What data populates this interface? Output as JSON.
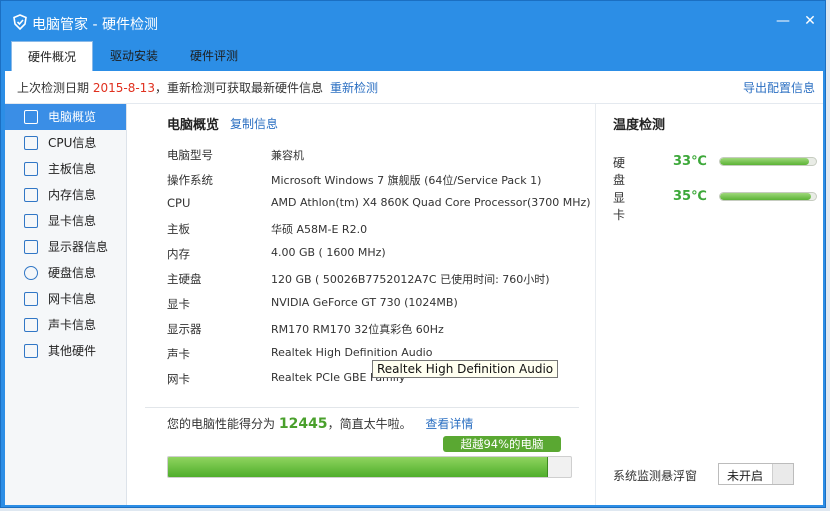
{
  "window": {
    "title": "电脑管家 - 硬件检测",
    "minimize": "—",
    "close": "✕"
  },
  "tabs": [
    {
      "label": "硬件概况",
      "active": true
    },
    {
      "label": "驱动安装",
      "active": false
    },
    {
      "label": "硬件评测",
      "active": false
    }
  ],
  "infobar": {
    "prefix": "上次检测日期",
    "date": "2015-8-13",
    "suffix": "，重新检测可获取最新硬件信息",
    "recheck": "重新检测",
    "export": "导出配置信息"
  },
  "sidebar": [
    {
      "label": "电脑概览",
      "icon": "overview-icon",
      "active": true
    },
    {
      "label": "CPU信息",
      "icon": "cpu-icon"
    },
    {
      "label": "主板信息",
      "icon": "motherboard-icon"
    },
    {
      "label": "内存信息",
      "icon": "memory-icon"
    },
    {
      "label": "显卡信息",
      "icon": "gpu-icon"
    },
    {
      "label": "显示器信息",
      "icon": "monitor-icon"
    },
    {
      "label": "硬盘信息",
      "icon": "disk-icon"
    },
    {
      "label": "网卡信息",
      "icon": "network-icon"
    },
    {
      "label": "声卡信息",
      "icon": "sound-icon"
    },
    {
      "label": "其他硬件",
      "icon": "other-hardware-icon"
    }
  ],
  "overview": {
    "title": "电脑概览",
    "copy": "复制信息",
    "rows": [
      {
        "key": "电脑型号",
        "value": "兼容机"
      },
      {
        "key": "操作系统",
        "value": "Microsoft Windows 7 旗舰版 (64位/Service Pack 1)"
      },
      {
        "key": "CPU",
        "value": "AMD Athlon(tm) X4 860K Quad Core Processor(3700 MHz)"
      },
      {
        "key": "主板",
        "value": "华硕 A58M-E R2.0"
      },
      {
        "key": "内存",
        "value": "4.00 GB (   1600 MHz)"
      },
      {
        "key": "主硬盘",
        "value": "120 GB ( 50026B7752012A7C 已使用时间: 760小时)"
      },
      {
        "key": "显卡",
        "value": "NVIDIA GeForce GT 730 (1024MB)"
      },
      {
        "key": "显示器",
        "value": "RM170 RM170  32位真彩色 60Hz"
      },
      {
        "key": "声卡",
        "value": "Realtek High Definition Audio"
      },
      {
        "key": "网卡",
        "value": "Realtek PCIe GBE Family"
      }
    ],
    "tooltip": "Realtek High Definition Audio"
  },
  "score": {
    "prefix": "您的电脑性能得分为",
    "value": "12445",
    "suffix": "，简直太牛啦。",
    "details": "查看详情",
    "badge": "超越94%的电脑",
    "percent": 94
  },
  "temperature": {
    "title": "温度检测",
    "items": [
      {
        "label": "硬盘",
        "value": "33℃",
        "level": 0.33
      },
      {
        "label": "显卡",
        "value": "35℃",
        "level": 0.35
      }
    ]
  },
  "float_monitor": {
    "label": "系统监测悬浮窗",
    "state": "未开启"
  },
  "colors": {
    "accent": "#2c8ee6",
    "score": "#4aa02c",
    "alert_date": "#e0301e"
  }
}
